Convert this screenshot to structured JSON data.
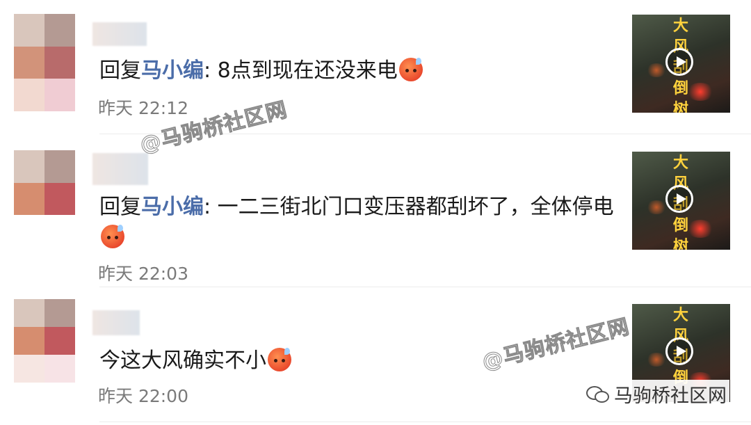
{
  "comments": [
    {
      "prefix": "回复",
      "mention": "马小编",
      "sep": ": ",
      "text": "8点到现在还没来电",
      "emoji": "sweat-face-emoji",
      "time": "昨天 22:12",
      "video_title": "大风刮倒树"
    },
    {
      "prefix": "回复",
      "mention": "马小编",
      "sep": ": ",
      "text": "一二三街北门口变压器都刮坏了，全体停电",
      "emoji": "sweat-face-emoji",
      "time": "昨天 22:03",
      "video_title": "大风刮倒树"
    },
    {
      "prefix": "",
      "mention": "",
      "sep": "",
      "text": "今这大风确实不小",
      "emoji": "sweat-face-emoji",
      "time": "昨天 22:00",
      "video_title": "大风刮倒"
    }
  ],
  "watermarks": [
    "@马驹桥社区网",
    "@马驹桥社区网"
  ],
  "brand": {
    "icon": "wechat-icon",
    "label": "马驹桥社区网"
  },
  "colors": {
    "mention": "#4b6da9",
    "time": "#7a7a7a",
    "video_title": "#ffd23d"
  }
}
